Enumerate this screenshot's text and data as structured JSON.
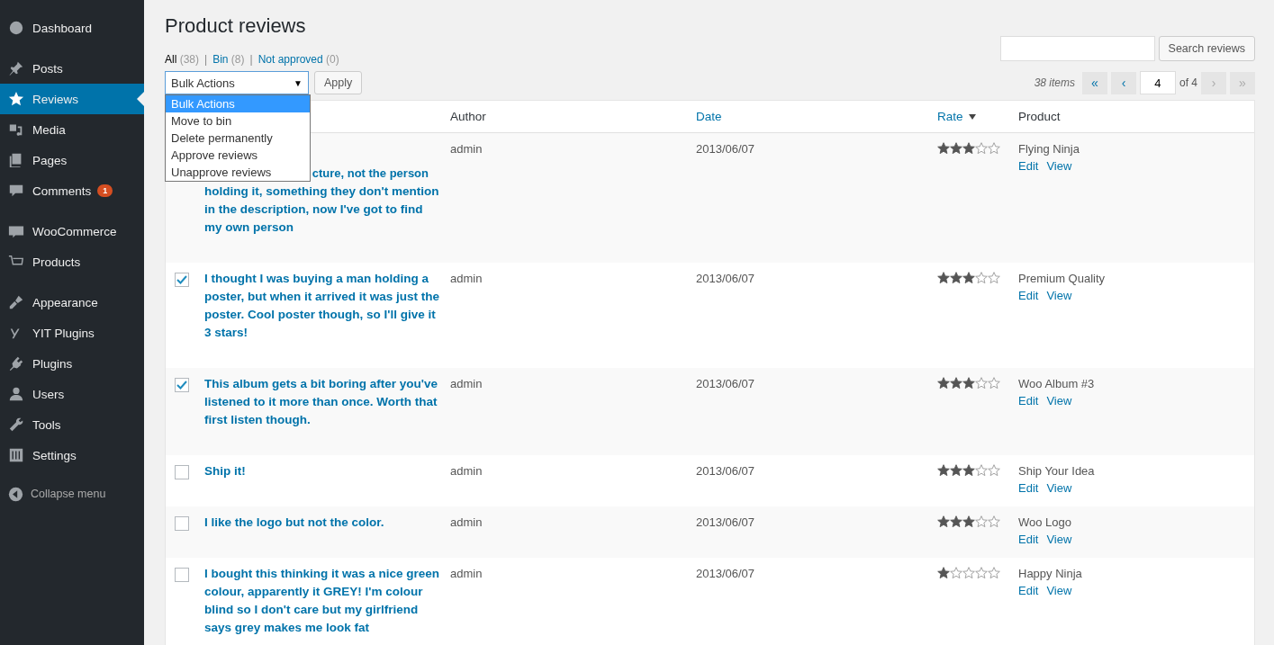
{
  "sidebar": {
    "groups": [
      {
        "items": [
          {
            "label": "Dashboard",
            "selected": false
          }
        ]
      },
      {
        "items": [
          {
            "label": "Posts",
            "selected": false
          },
          {
            "label": "Reviews",
            "selected": true
          },
          {
            "label": "Media",
            "selected": false
          },
          {
            "label": "Pages",
            "selected": false
          },
          {
            "label": "Comments",
            "selected": false,
            "badge": "1"
          }
        ]
      },
      {
        "items": [
          {
            "label": "WooCommerce",
            "selected": false
          },
          {
            "label": "Products",
            "selected": false
          }
        ]
      },
      {
        "items": [
          {
            "label": "Appearance",
            "selected": false
          },
          {
            "label": "YIT Plugins",
            "selected": false
          },
          {
            "label": "Plugins",
            "selected": false
          },
          {
            "label": "Users",
            "selected": false
          },
          {
            "label": "Tools",
            "selected": false
          },
          {
            "label": "Settings",
            "selected": false
          }
        ]
      }
    ],
    "collapse": "Collapse menu"
  },
  "page_title": "Product reviews",
  "filters": [
    {
      "label": "All",
      "count": "(38)",
      "selected": true
    },
    {
      "separator": "|",
      "label": "Bin",
      "count": "(8)",
      "selected": false
    },
    {
      "separator": "|",
      "label": "Not approved",
      "count": "(0)",
      "selected": false
    }
  ],
  "search": {
    "button": "Search reviews"
  },
  "bulk_actions": {
    "value": "Bulk Actions",
    "caret": "▼",
    "options": [
      {
        "label": "Bulk Actions",
        "selected": true
      },
      {
        "label": "Move to bin",
        "selected": false
      },
      {
        "label": "Delete permanently",
        "selected": false
      },
      {
        "label": "Approve reviews",
        "selected": false
      },
      {
        "label": "Unapprove reviews",
        "selected": false
      }
    ],
    "apply": "Apply"
  },
  "pagination": {
    "items": "38 items",
    "first": "«",
    "prev": "‹",
    "page": "4",
    "of": "of 4",
    "next": "›",
    "last": "»"
  },
  "table": {
    "columns": [
      {
        "label": "Author",
        "sortable": false,
        "sorted": false
      },
      {
        "label": "Date",
        "sortable": true,
        "sorted": false
      },
      {
        "label": "Rate",
        "sortable": true,
        "sorted": true
      },
      {
        "label": "Product",
        "sortable": false,
        "sorted": false
      }
    ],
    "rows": [
      {
        "review_tail": "cture, not the person",
        "review": "holding it, something they don't mention in the description, now I've got to find my own person",
        "author": "admin",
        "date": "2013/06/07",
        "stars": 3,
        "product": "Flying Ninja",
        "actions": [
          "Edit",
          "View"
        ]
      },
      {
        "checked": true,
        "review": "I thought I was buying a man holding a poster, but when it arrived it was just the poster. Cool poster though, so I'll give it 3 stars!",
        "author": "admin",
        "date": "2013/06/07",
        "stars": 3,
        "product": "Premium Quality",
        "actions": [
          "Edit",
          "View"
        ]
      },
      {
        "checked": true,
        "review": "This album gets a bit boring after you've listened to it more than once. Worth that first listen though.",
        "author": "admin",
        "date": "2013/06/07",
        "stars": 3,
        "product": "Woo Album #3",
        "actions": [
          "Edit",
          "View"
        ]
      },
      {
        "checked": false,
        "review": "Ship it!",
        "author": "admin",
        "date": "2013/06/07",
        "stars": 3,
        "product": "Ship Your Idea",
        "actions": [
          "Edit",
          "View"
        ]
      },
      {
        "checked": false,
        "review": "I like the logo but not the color.",
        "author": "admin",
        "date": "2013/06/07",
        "stars": 3,
        "product": "Woo Logo",
        "actions": [
          "Edit",
          "View"
        ]
      },
      {
        "checked": false,
        "review": "I bought this thinking it was a nice green colour, apparently it GREY! I'm colour blind so I don't care but my girlfriend says grey makes me look fat",
        "author": "admin",
        "date": "2013/06/07",
        "stars": 1,
        "product": "Happy Ninja",
        "actions": [
          "Edit",
          "View"
        ]
      }
    ]
  }
}
